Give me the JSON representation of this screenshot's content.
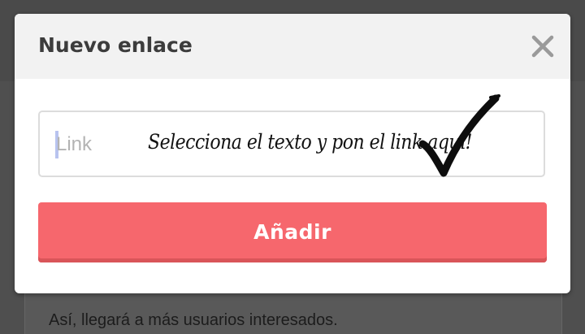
{
  "dialog": {
    "title": "Nuevo enlace",
    "close_icon": "close-icon",
    "link_input": {
      "placeholder": "Link",
      "value": ""
    },
    "annotation": "Selecciona el texto y pon el link aquí!",
    "annotation_icon": "checkmark-icon",
    "add_button_label": "Añadir"
  },
  "background": {
    "text": "Así, llegará a más usuarios interesados."
  },
  "colors": {
    "accent": "#f6676d",
    "header_bg": "#f2f2f2",
    "overlay": "#4f4f4f"
  }
}
